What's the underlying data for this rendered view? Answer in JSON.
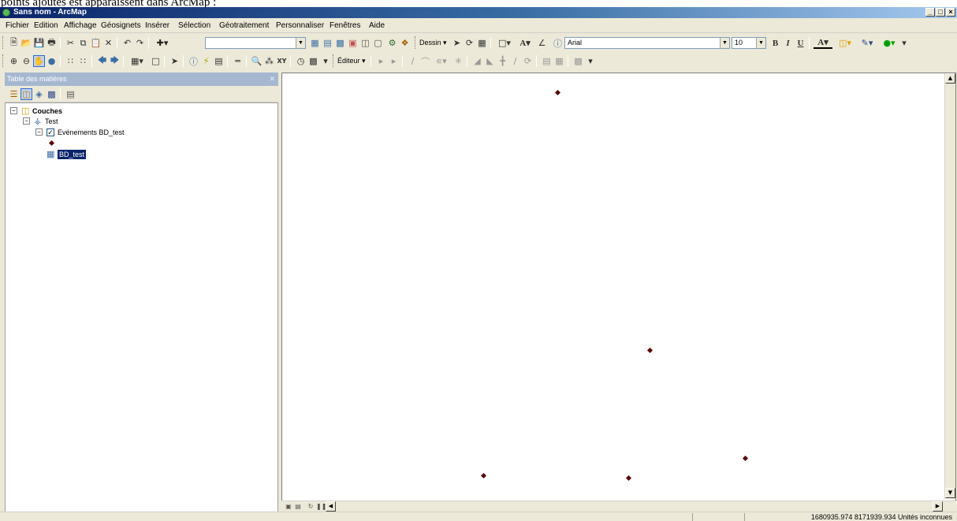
{
  "caption_text": "points ajoutés est apparaîssent dans ArcMap :",
  "window": {
    "title": "Sans nom - ArcMap",
    "controls": [
      "_",
      "□",
      "×"
    ]
  },
  "menu": [
    "Fichier",
    "Edition",
    "Affichage",
    "Géosignets",
    "Insérer",
    "Sélection",
    "Géotraitement",
    "Personnaliser",
    "Fenêtres",
    "Aide"
  ],
  "toolbar": {
    "scale_value": "",
    "dessin_label": "Dessin",
    "editeur_label": "Éditeur",
    "font_name": "Arial",
    "font_size": "10",
    "bold": "B",
    "italic": "I",
    "underline": "U",
    "font_color_label": "A"
  },
  "toc": {
    "title": "Table des matières",
    "close": "✕",
    "tree": {
      "root": "Couches",
      "dataframe": "Test",
      "layer": "Evénements BD_test",
      "layer_checked": true,
      "table": "BD_test"
    }
  },
  "map": {
    "point_color": "#5a0a0a",
    "point_count": 5
  },
  "status": {
    "coordinates": "1680935.974  8171939.934 Unités inconnues"
  }
}
